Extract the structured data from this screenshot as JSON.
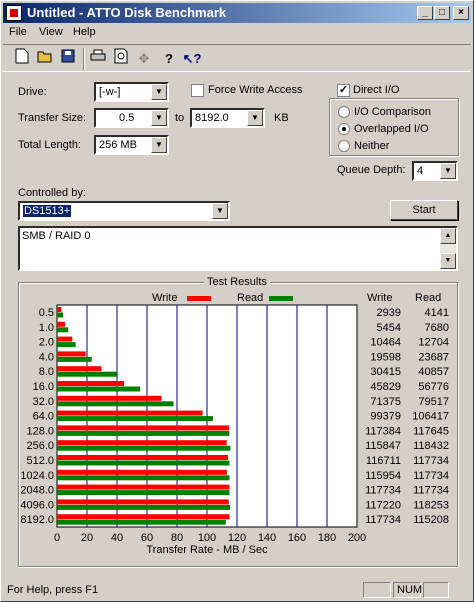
{
  "window": {
    "title": "Untitled - ATTO Disk Benchmark",
    "min": "_",
    "max": "□",
    "close": "×"
  },
  "menu": [
    "File",
    "View",
    "Help"
  ],
  "toolbar": [
    "new-icon",
    "open-icon",
    "save-icon",
    "print-icon",
    "print-preview-icon",
    "move-icon",
    "help-icon",
    "context-help-icon"
  ],
  "form": {
    "drive_label": "Drive:",
    "drive_value": "[-w-]",
    "force_write_label": "Force Write Access",
    "force_write_checked": false,
    "direct_io_label": "Direct I/O",
    "direct_io_checked": true,
    "transfer_label": "Transfer Size:",
    "transfer_from": "0.5",
    "to_label": "to",
    "transfer_to": "8192.0",
    "kb_label": "KB",
    "total_label": "Total Length:",
    "total_value": "256 MB",
    "radio_io_comparison": "I/O Comparison",
    "radio_overlapped": "Overlapped I/O",
    "radio_neither": "Neither",
    "selected_radio": "Overlapped I/O",
    "queue_label": "Queue Depth:",
    "queue_value": "4",
    "controlled_label": "Controlled by:",
    "controlled_value": "DS1513+",
    "start_label": "Start",
    "description": "SMB / RAID 0"
  },
  "results": {
    "group_title": "Test Results",
    "write_legend": "Write",
    "read_legend": "Read",
    "write_header": "Write",
    "read_header": "Read",
    "xlabel": "Transfer Rate - MB / Sec"
  },
  "chart_data": {
    "type": "bar",
    "orientation": "horizontal",
    "categories": [
      "0.5",
      "1.0",
      "2.0",
      "4.0",
      "8.0",
      "16.0",
      "32.0",
      "64.0",
      "128.0",
      "256.0",
      "512.0",
      "1024.0",
      "2048.0",
      "4096.0",
      "8192.0"
    ],
    "series": [
      {
        "name": "Write",
        "color": "#ff0000",
        "values": [
          2939,
          5454,
          10464,
          19598,
          30415,
          45829,
          71375,
          99379,
          117384,
          115847,
          116711,
          115954,
          117734,
          117220,
          117734
        ]
      },
      {
        "name": "Read",
        "color": "#008000",
        "values": [
          4141,
          7680,
          12704,
          23687,
          40857,
          56776,
          79517,
          106417,
          117645,
          118432,
          117734,
          117734,
          117734,
          118253,
          115208
        ]
      }
    ],
    "write_labels": [
      "2939",
      "5454",
      "10464",
      "19598",
      "30415",
      "45829",
      "71375",
      "99379",
      "117384",
      "115847",
      "116711",
      "115954",
      "117734",
      "117220",
      "117734"
    ],
    "read_labels": [
      "4141",
      "7680",
      "12704",
      "23687",
      "40857",
      "56776",
      "79517",
      "106417",
      "117645",
      "118432",
      "117734",
      "117734",
      "117734",
      "118253",
      "115208"
    ],
    "xticks": [
      "0",
      "20",
      "40",
      "60",
      "80",
      "100",
      "120",
      "140",
      "160",
      "180",
      "200"
    ],
    "xlim": [
      0,
      200
    ],
    "xlabel": "Transfer Rate - MB / Sec",
    "legend": "top",
    "grid": true
  },
  "status": {
    "text": "For Help, press F1",
    "num": "NUM"
  }
}
